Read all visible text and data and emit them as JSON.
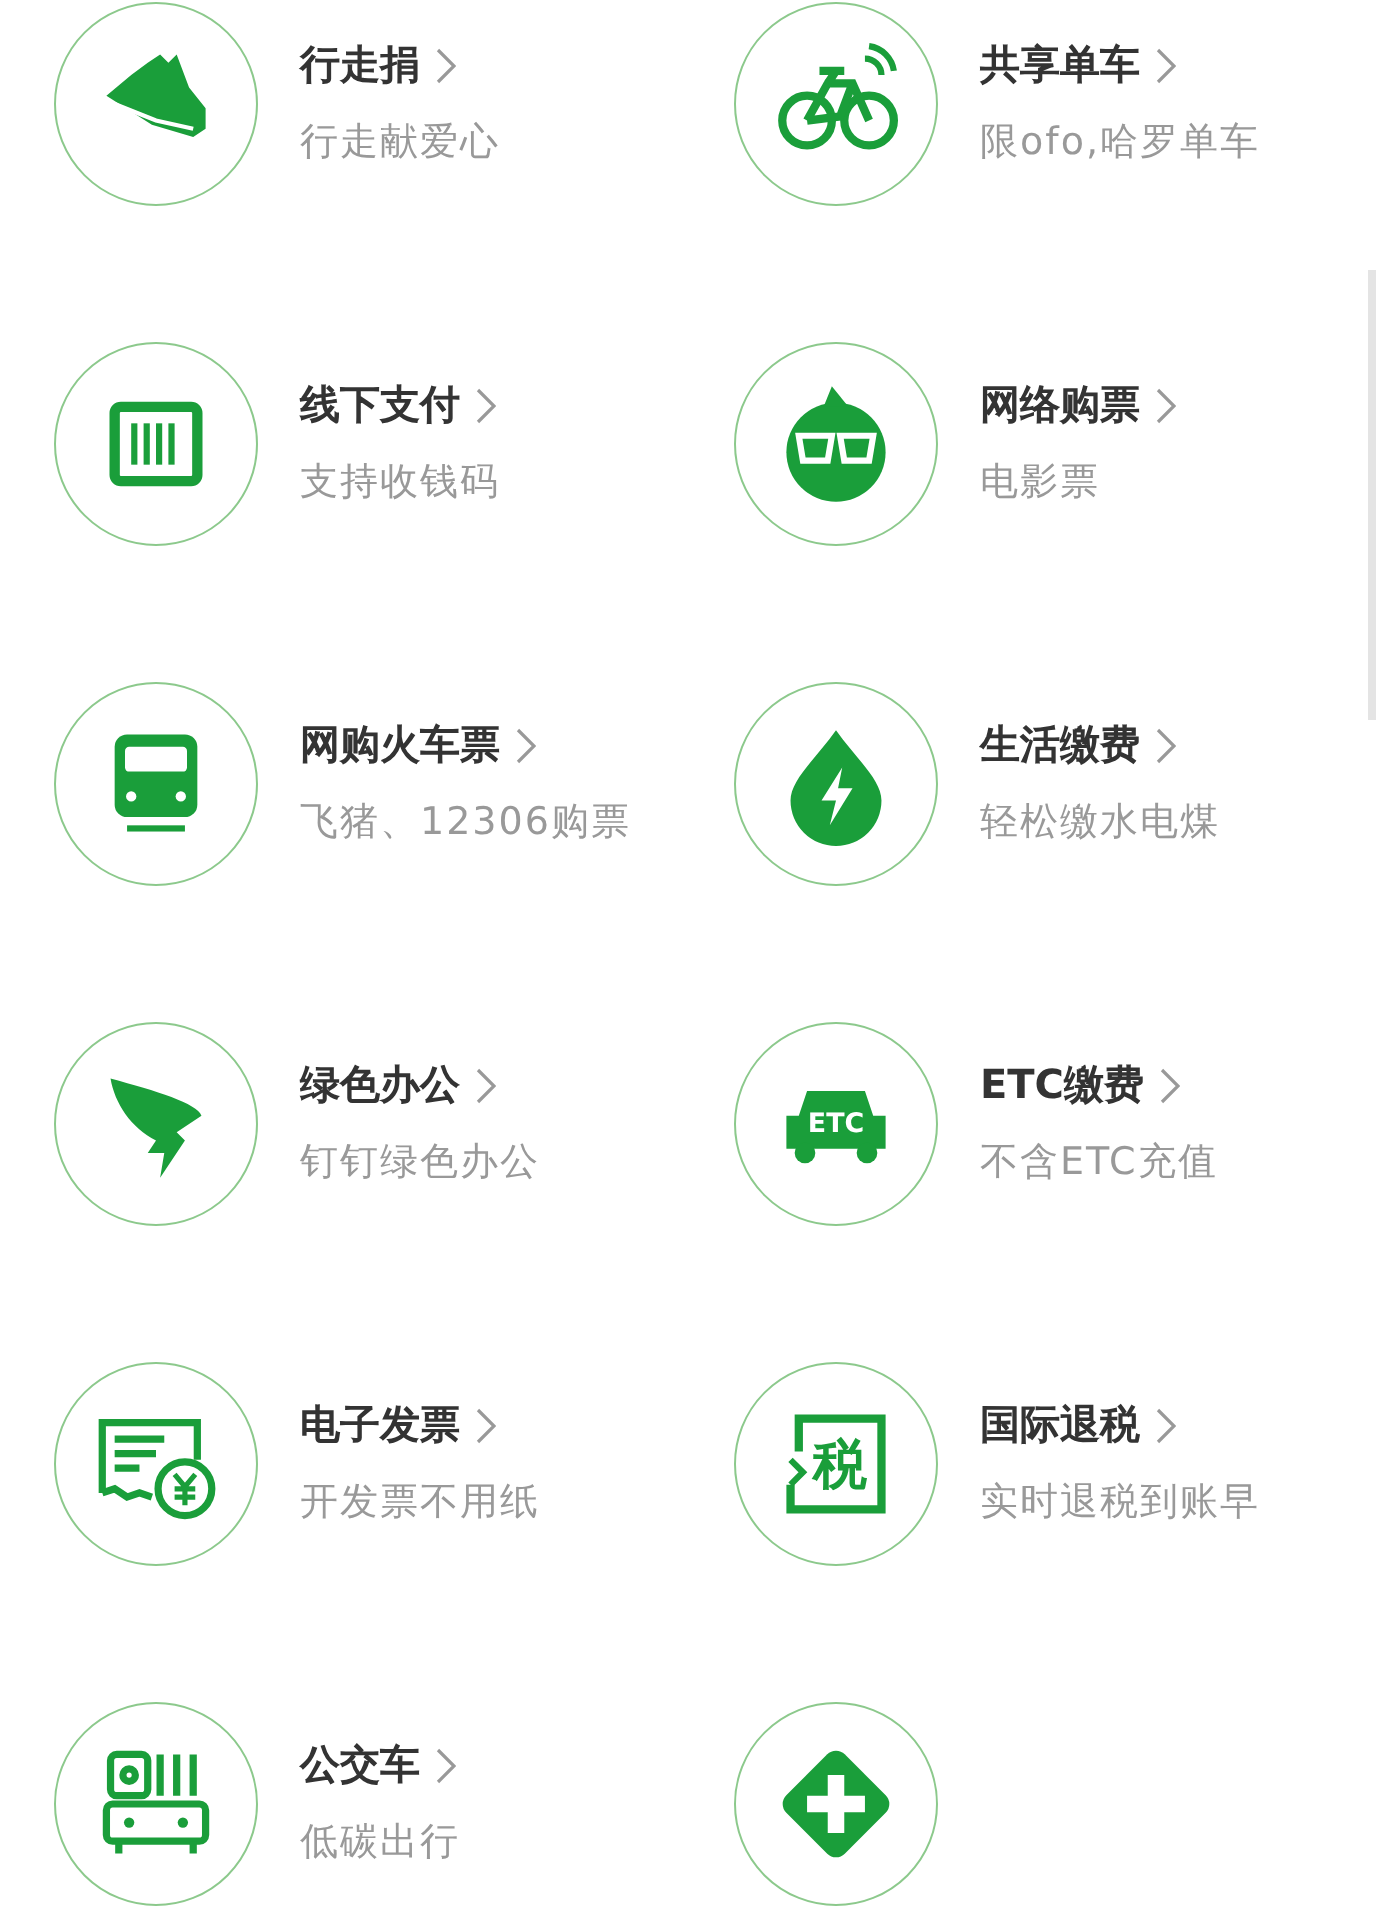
{
  "services": [
    {
      "kind": "shoe",
      "title": "行走捐",
      "subtitle": "行走献爱心"
    },
    {
      "kind": "bike",
      "title": "共享单车",
      "subtitle": "限ofo,哈罗单车"
    },
    {
      "kind": "barcode",
      "title": "线下支付",
      "subtitle": "支持收钱码"
    },
    {
      "kind": "glasses",
      "title": "网络购票",
      "subtitle": "电影票"
    },
    {
      "kind": "train",
      "title": "网购火车票",
      "subtitle": "飞猪、12306购票"
    },
    {
      "kind": "drop",
      "title": "生活缴费",
      "subtitle": "轻松缴水电煤"
    },
    {
      "kind": "wing",
      "title": "绿色办公",
      "subtitle": "钉钉绿色办公"
    },
    {
      "kind": "car",
      "icon_text": "ETC",
      "title": "ETC缴费",
      "subtitle": "不含ETC充值"
    },
    {
      "kind": "invoice",
      "title": "电子发票",
      "subtitle": "开发票不用纸"
    },
    {
      "kind": "tax",
      "icon_text": "税",
      "title": "国际退税",
      "subtitle": "实时退税到账早"
    },
    {
      "kind": "bus",
      "title": "公交车",
      "subtitle": "低碳出行"
    },
    {
      "kind": "plus"
    }
  ]
}
